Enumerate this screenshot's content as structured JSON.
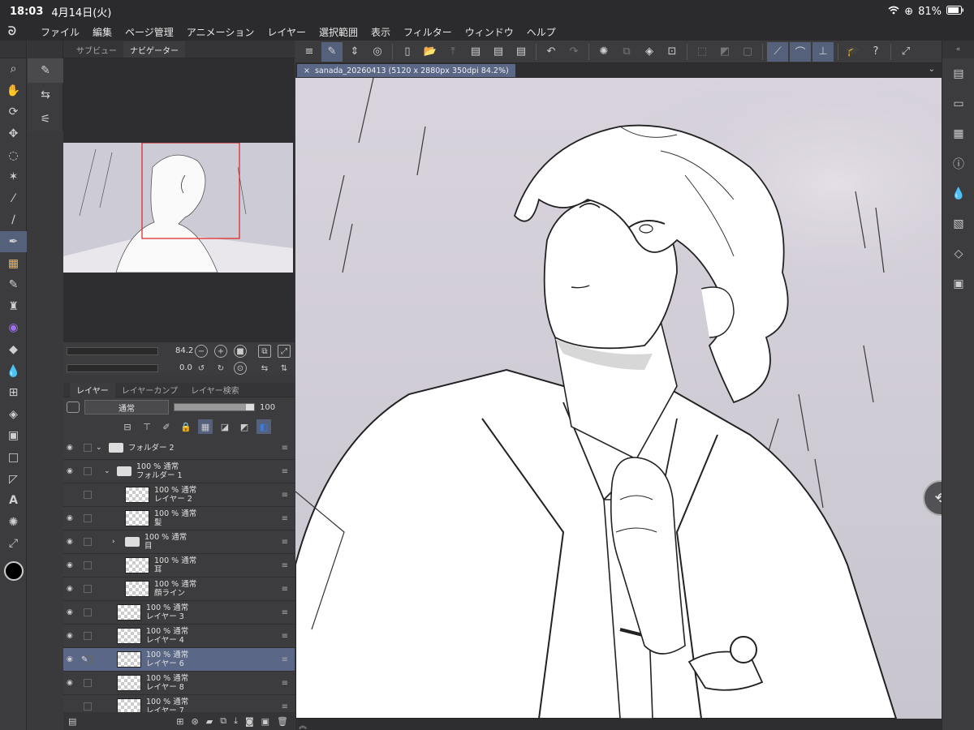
{
  "status": {
    "time": "18:03",
    "date": "4月14日(火)",
    "wifi_icon": "wifi-icon",
    "battery": "81%"
  },
  "menu": {
    "logo": "ᘐ",
    "items": [
      "ファイル",
      "編集",
      "ページ管理",
      "アニメーション",
      "レイヤー",
      "選択範囲",
      "表示",
      "フィルター",
      "ウィンドウ",
      "ヘルプ"
    ]
  },
  "navigator": {
    "tabs": [
      "サブビュー",
      "ナビゲーター"
    ],
    "zoom": "84.2",
    "rotation": "0.0"
  },
  "document": {
    "tab_label": "sanada_20260413 (5120 x 2880px 350dpi 84.2%)"
  },
  "layers": {
    "tabs": [
      "レイヤー",
      "レイヤーカンプ",
      "レイヤー検索"
    ],
    "blend_mode": "通常",
    "opacity": "100",
    "rows": [
      {
        "name": "フォルダー 2",
        "mode": "",
        "type": "folder",
        "indent": 1,
        "visible": true,
        "selected": false
      },
      {
        "name": "フォルダー 1",
        "mode": "100 % 通常",
        "type": "folder",
        "indent": 2,
        "visible": true,
        "selected": false
      },
      {
        "name": "レイヤー 2",
        "mode": "100 % 通常",
        "type": "layer",
        "indent": 3,
        "visible": false,
        "selected": false
      },
      {
        "name": "髪",
        "mode": "100 % 通常",
        "type": "layer",
        "indent": 3,
        "visible": true,
        "selected": false
      },
      {
        "name": "目",
        "mode": "100 % 通常",
        "type": "folder",
        "indent": 3,
        "visible": true,
        "selected": false
      },
      {
        "name": "耳",
        "mode": "100 % 通常",
        "type": "layer",
        "indent": 3,
        "visible": true,
        "selected": false
      },
      {
        "name": "顔ライン",
        "mode": "100 % 通常",
        "type": "layer",
        "indent": 3,
        "visible": true,
        "selected": false
      },
      {
        "name": "レイヤー 3",
        "mode": "100 % 通常",
        "type": "layer",
        "indent": 2,
        "visible": true,
        "selected": false
      },
      {
        "name": "レイヤー 4",
        "mode": "100 % 通常",
        "type": "layer",
        "indent": 2,
        "visible": true,
        "selected": false
      },
      {
        "name": "レイヤー 6",
        "mode": "100 % 通常",
        "type": "layer",
        "indent": 2,
        "visible": true,
        "selected": true
      },
      {
        "name": "レイヤー 8",
        "mode": "100 % 通常",
        "type": "layer",
        "indent": 2,
        "visible": true,
        "selected": false
      },
      {
        "name": "レイヤー 7",
        "mode": "100 % 通常",
        "type": "layer",
        "indent": 2,
        "visible": false,
        "selected": false
      }
    ]
  },
  "tools": [
    "zoom-icon",
    "hand-icon",
    "rotate-icon",
    "move-icon",
    "lasso-icon",
    "magic-wand-icon",
    "eyedropper-icon",
    "pen-icon",
    "pencil-icon",
    "brush-icon",
    "airbrush-icon",
    "decoration-icon",
    "eraser-icon",
    "blend-icon",
    "fill-icon",
    "gradient-icon",
    "shape-icon",
    "frame-icon",
    "ruler-icon",
    "text-icon",
    "balloon-icon",
    "line-correction-icon"
  ],
  "right_panel": [
    "layer-property-icon",
    "tool-property-icon",
    "subtool-detail-icon",
    "info-icon",
    "color-icon",
    "material-icon",
    "layer-stack-icon",
    "timeline-icon"
  ],
  "colors": {
    "accent": "#5b6787",
    "panel": "#3c3c3e",
    "nav_frame": "#e02020"
  }
}
